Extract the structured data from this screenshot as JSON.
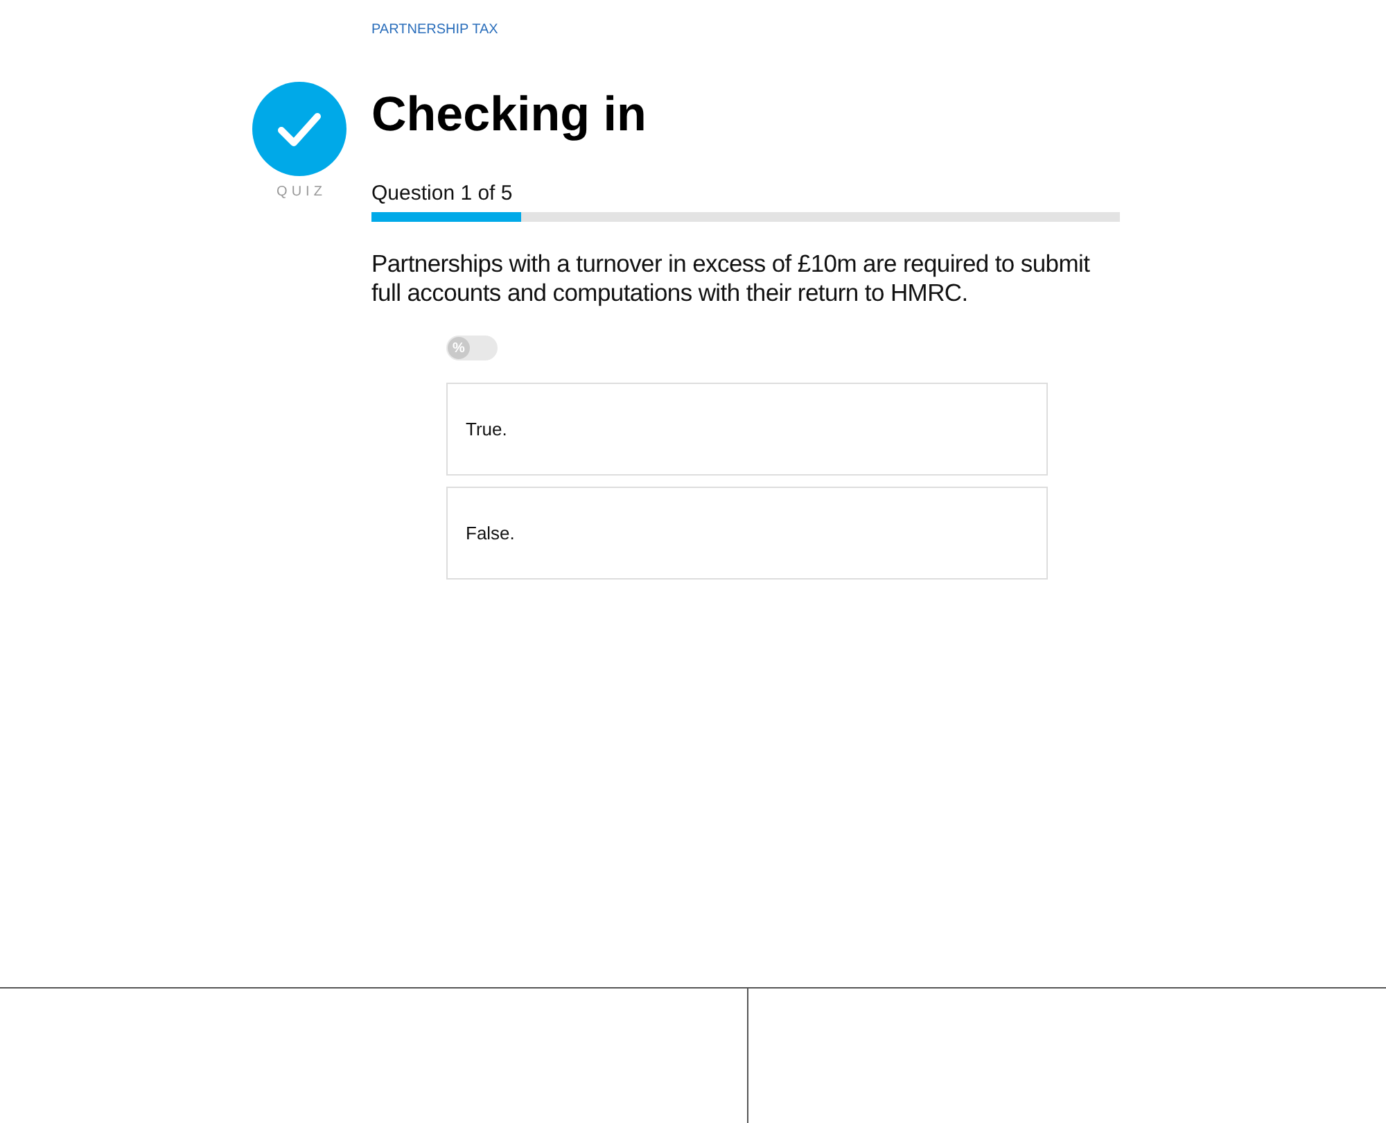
{
  "breadcrumb": "PARTNERSHIP TAX",
  "badge": {
    "label": "QUIZ"
  },
  "title": "Checking in",
  "progress": {
    "label": "Question 1 of 5",
    "level": 0.2
  },
  "question": "Partnerships with a turnover in excess of £10m are required to submit full accounts and computations with their return to HMRC.",
  "toggle": {
    "label": "%",
    "on": false
  },
  "answers": [
    {
      "label": "True.",
      "selected": false
    },
    {
      "label": "False.",
      "selected": false
    }
  ]
}
